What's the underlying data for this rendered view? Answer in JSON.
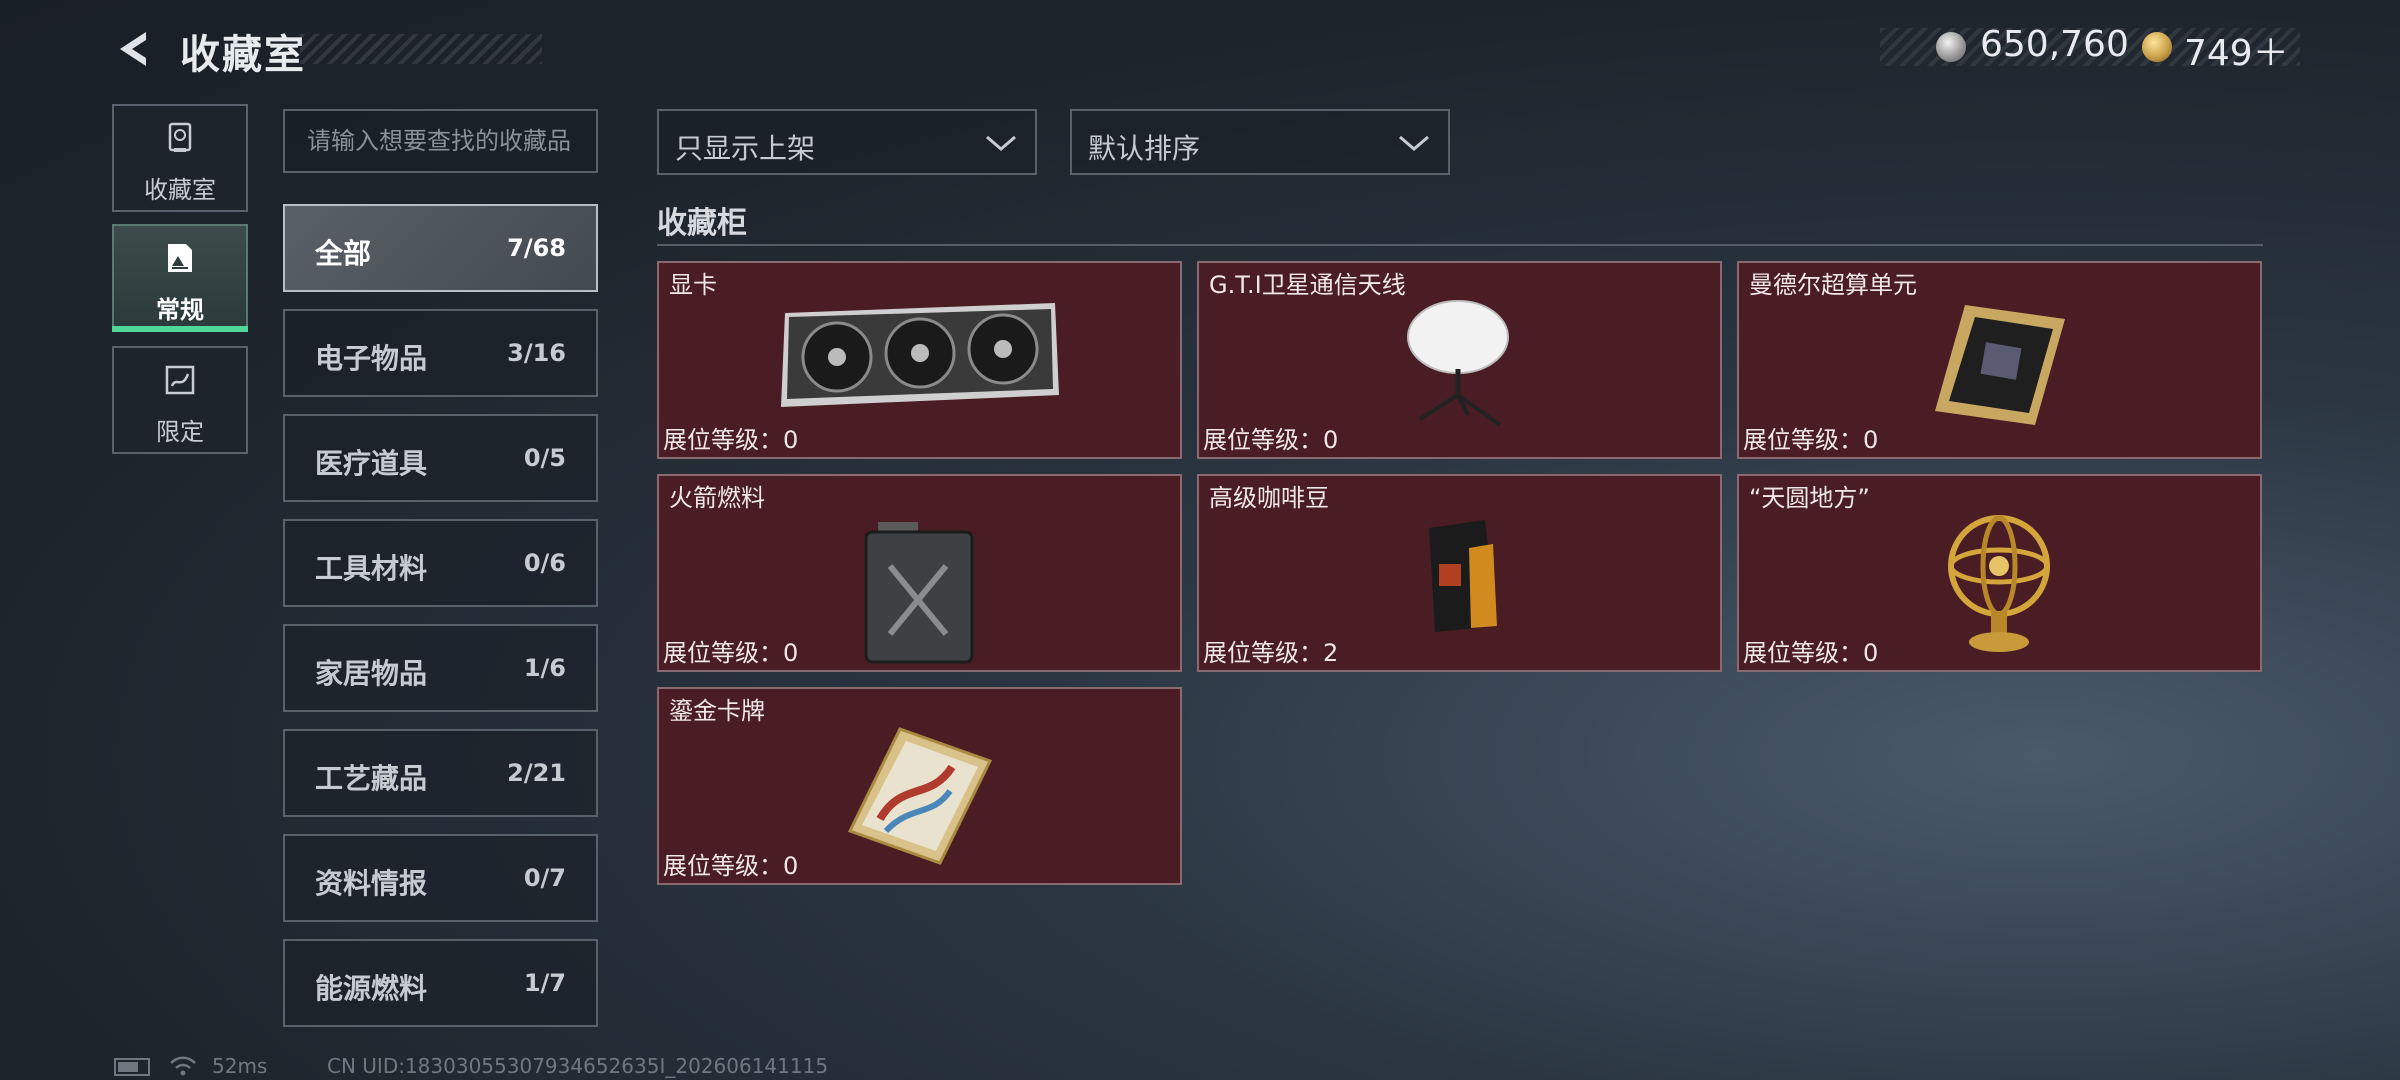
{
  "header": {
    "title": "收藏室",
    "currency_silver": "650,760",
    "currency_gold": "749＋"
  },
  "left_nav": [
    {
      "label": "收藏室",
      "icon": "trophy-icon",
      "active": false
    },
    {
      "label": "常规",
      "icon": "picture-icon",
      "active": true
    },
    {
      "label": "限定",
      "icon": "limited-icon",
      "active": false
    }
  ],
  "search": {
    "placeholder": "请输入想要查找的收藏品"
  },
  "categories": [
    {
      "name": "全部",
      "count": "7/68",
      "active": true
    },
    {
      "name": "电子物品",
      "count": "3/16"
    },
    {
      "name": "医疗道具",
      "count": "0/5"
    },
    {
      "name": "工具材料",
      "count": "0/6"
    },
    {
      "name": "家居物品",
      "count": "1/6"
    },
    {
      "name": "工艺藏品",
      "count": "2/21"
    },
    {
      "name": "资料情报",
      "count": "0/7"
    },
    {
      "name": "能源燃料",
      "count": "1/7"
    }
  ],
  "filters": {
    "display": "只显示上架",
    "sort": "默认排序"
  },
  "section_title": "收藏柜",
  "items": [
    {
      "name": "显卡",
      "level": "展位等级：0",
      "icon": "graphics-card-icon"
    },
    {
      "name": "G.T.I卫星通信天线",
      "level": "展位等级：0",
      "icon": "satellite-dish-icon"
    },
    {
      "name": "曼德尔超算单元",
      "level": "展位等级：0",
      "icon": "processor-icon"
    },
    {
      "name": "火箭燃料",
      "level": "展位等级：0",
      "icon": "fuel-can-icon"
    },
    {
      "name": "高级咖啡豆",
      "level": "展位等级：2",
      "icon": "coffee-bag-icon"
    },
    {
      "name": "“天圆地方”",
      "level": "展位等级：0",
      "icon": "armillary-sphere-icon"
    },
    {
      "name": "鎏金卡牌",
      "level": "展位等级：0",
      "icon": "gold-card-icon"
    }
  ],
  "status_bar": {
    "ping": "52ms",
    "uid": "CN UID:18303055307934652635I_202606141115"
  },
  "colors": {
    "accent_green": "#4fd89a",
    "card_bg": "#4a1c24"
  }
}
